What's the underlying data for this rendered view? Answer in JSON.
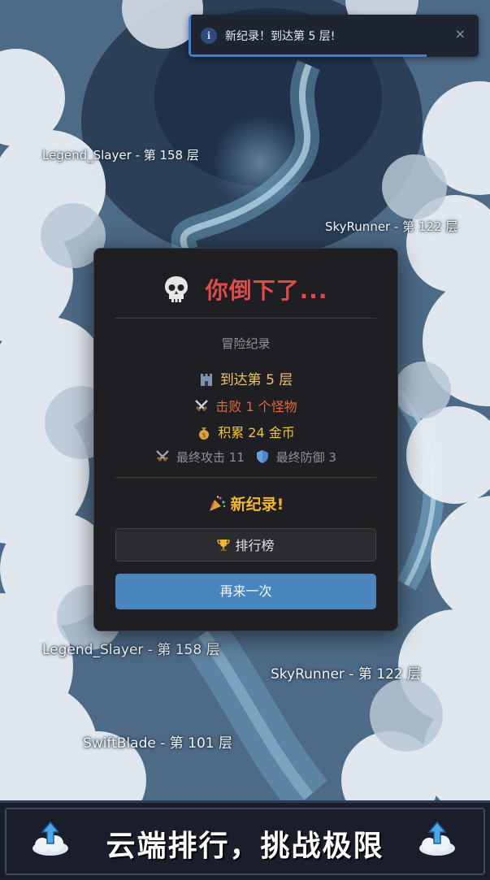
{
  "toast": {
    "message": "新纪录！到达第 5 层!",
    "info_icon": "i",
    "close_label": "×"
  },
  "background_labels": [
    "Legend_Slayer - 第 158 层",
    "SkyRunner - 第 122 层",
    "Legend_Slayer - 第 158 层",
    "SkyRunner - 第 122 层",
    "SwiftBlade - 第 101 层"
  ],
  "modal": {
    "title": "你倒下了...",
    "section_title": "冒险纪录",
    "floor_text": "到达第 5 层",
    "kills_text": "击败 1 个怪物",
    "gold_text": "积累 24 金币",
    "final_attack": "最终攻击 11",
    "final_defense": "最终防御 3",
    "new_record": "新纪录!",
    "leaderboard_label": "排行榜",
    "retry_label": "再来一次"
  },
  "banner": {
    "text": "云端排行，挑战极限"
  },
  "icons": [
    "skull-icon",
    "castle-icon",
    "swords-icon",
    "money-bag-icon",
    "shield-icon",
    "party-popper-icon",
    "trophy-icon",
    "cloud-upload-icon"
  ],
  "colors": {
    "title_red": "#e04a48",
    "gold": "#f2b531",
    "retry_blue": "#4a86bd",
    "toast_accent": "#3d7fd4"
  }
}
